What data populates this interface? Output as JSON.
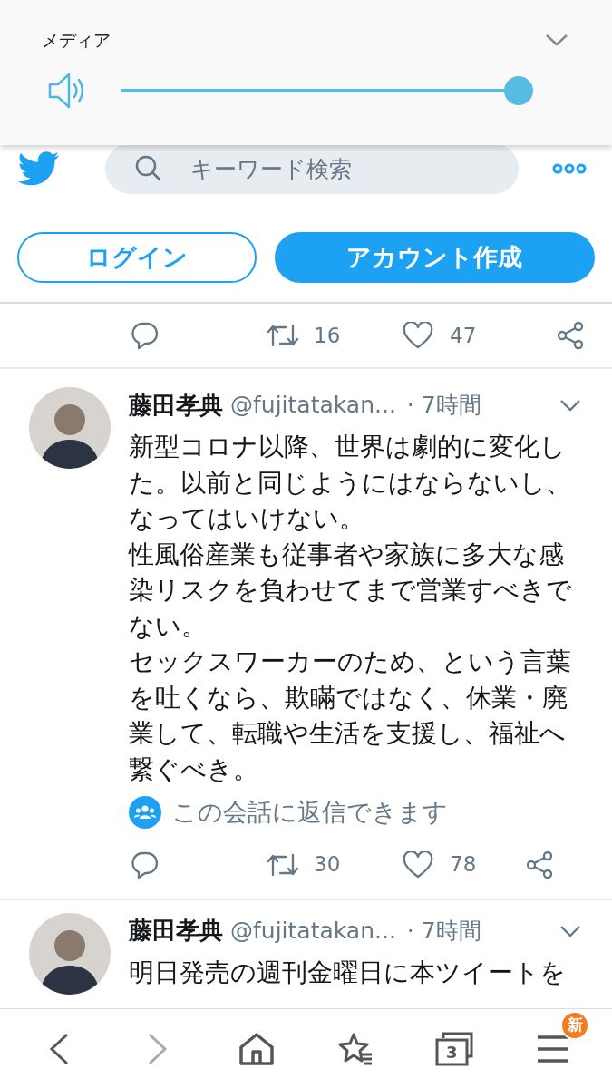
{
  "media_panel": {
    "title": "メディア",
    "volume": {
      "level": 1.0
    }
  },
  "header": {
    "search": {
      "placeholder": "キーワード検索"
    }
  },
  "auth_buttons": [
    {
      "label": "ログイン",
      "kind": "outline"
    },
    {
      "label": "アカウント作成",
      "kind": "filled"
    }
  ],
  "previous_tweet_actions": {
    "retweets": "16",
    "likes": "47"
  },
  "tweets": [
    {
      "name": "藤田孝典",
      "handle": "@fujitatakan...",
      "time": "· 7時間",
      "paragraphs": [
        "新型コロナ以降、世界は劇的に変化した。以前と同じようにはならないし、なってはいけない。",
        "性風俗産業も従事者や家族に多大な感染リスクを負わせてまで営業すべきでない。",
        "セックスワーカーのため、という言葉を吐くなら、欺瞞ではなく、休業・廃業して、転職や生活を支援し、福祉へ繋ぐべき。"
      ],
      "reply_note": "この会話に返信できます",
      "retweets": "30",
      "likes": "78"
    },
    {
      "name": "藤田孝典",
      "handle": "@fujitatakan...",
      "time": "· 7時間",
      "paragraphs": [
        "明日発売の週刊金曜日に本ツイートを"
      ]
    }
  ],
  "bottom_bar": [
    {
      "kind": "back",
      "disabled": false
    },
    {
      "kind": "forward",
      "disabled": true
    },
    {
      "kind": "home",
      "disabled": false
    },
    {
      "kind": "bookmarks",
      "disabled": false
    },
    {
      "kind": "tabs",
      "disabled": false,
      "count": "3"
    },
    {
      "kind": "menu",
      "disabled": false,
      "badge": "新"
    }
  ]
}
